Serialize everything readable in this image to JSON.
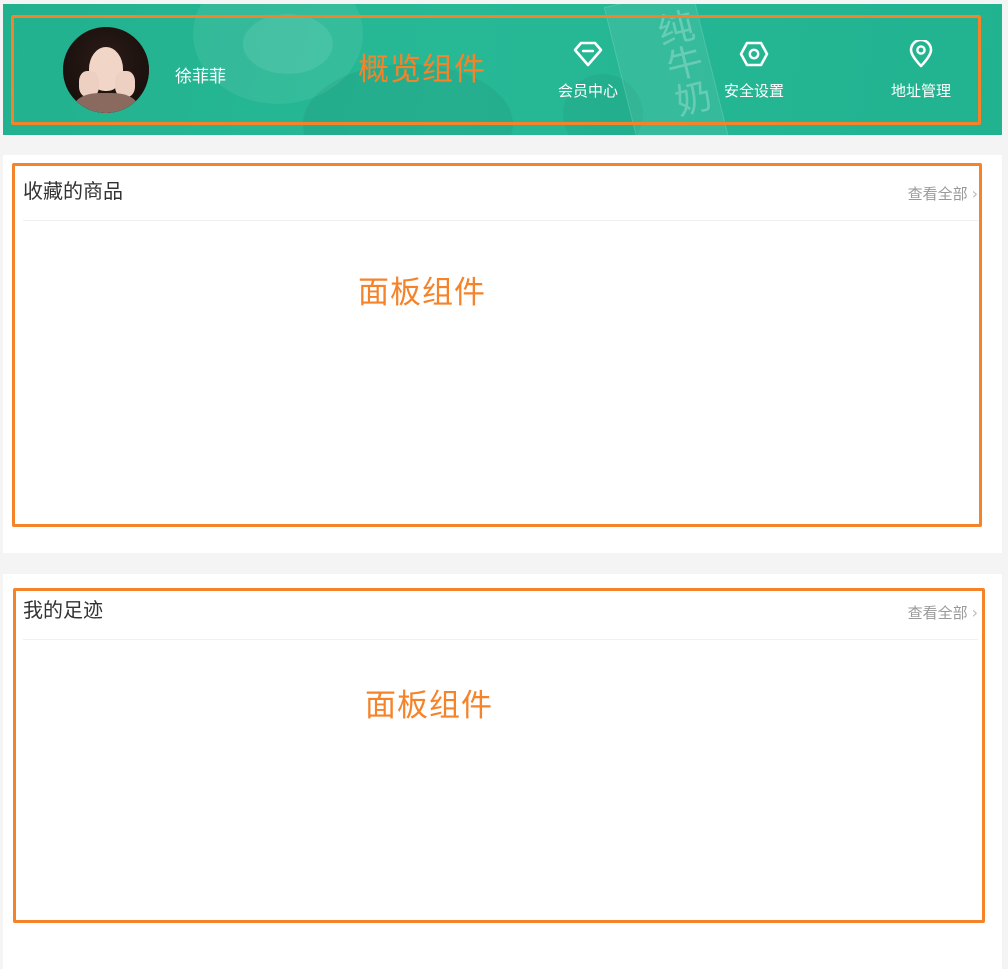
{
  "overview": {
    "username": "徐菲菲",
    "nav": [
      {
        "label": "会员中心",
        "icon": "diamond-icon"
      },
      {
        "label": "安全设置",
        "icon": "shield-gear-icon"
      },
      {
        "label": "地址管理",
        "icon": "location-pin-icon"
      }
    ],
    "background_text": "纯牛奶"
  },
  "panels": [
    {
      "title": "收藏的商品",
      "more_label": "查看全部",
      "chevron": "›"
    },
    {
      "title": "我的足迹",
      "more_label": "查看全部",
      "chevron": "›"
    }
  ],
  "annotations": {
    "overview_label": "概览组件",
    "panel_label_1": "面板组件",
    "panel_label_2": "面板组件",
    "color": "#f5832a"
  },
  "colors": {
    "header_green": "#22b18f",
    "page_bg": "#f4f4f4"
  }
}
